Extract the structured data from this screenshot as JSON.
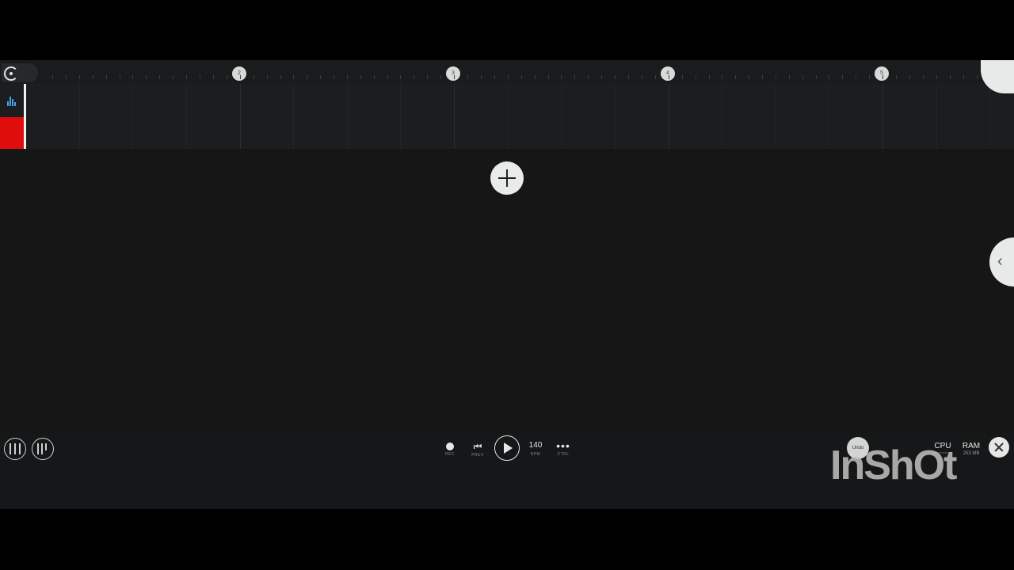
{
  "timeline": {
    "bar_markers": [
      "2",
      "3",
      "4",
      "5"
    ]
  },
  "transport": {
    "rec_label": "REC",
    "prev_label": "PREV",
    "bpm_value": "140",
    "bpm_label": "BPM",
    "ctrl_label": "CTRL"
  },
  "toolbar": {
    "undo_label": "Undo",
    "cpu_label": "CPU",
    "ram_label": "RAM",
    "ram_value": "253 MB"
  },
  "watermark": "InShOt",
  "colors": {
    "track_accent": "#e00d0d",
    "meter_accent": "#3ea7e8",
    "background": "#161617"
  }
}
